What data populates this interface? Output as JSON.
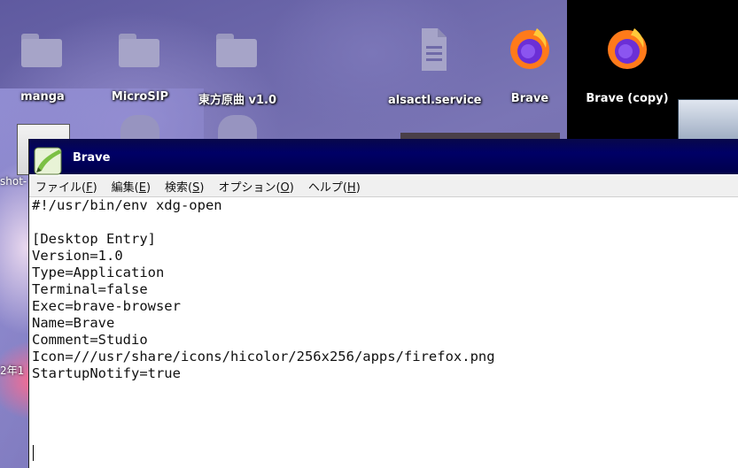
{
  "desktop": {
    "icons": [
      {
        "label": "manga",
        "icon": "folder-icon"
      },
      {
        "label": "MicroSIP",
        "icon": "folder-icon"
      },
      {
        "label": "東方原曲 v1.0",
        "icon": "folder-icon"
      },
      {
        "label": "alsactl.service",
        "icon": "document-icon"
      },
      {
        "label": "Brave",
        "icon": "firefox-icon"
      },
      {
        "label": "Brave (copy)",
        "icon": "firefox-icon"
      }
    ],
    "partial_label_left": "shot-",
    "partial_date_left": "2年1"
  },
  "window": {
    "title": "Brave",
    "app_icon": "text-editor-icon",
    "menu": [
      {
        "label": "ファイル(",
        "accel": "F",
        "tail": ")"
      },
      {
        "label": "編集(",
        "accel": "E",
        "tail": ")"
      },
      {
        "label": "検索(",
        "accel": "S",
        "tail": ")"
      },
      {
        "label": "オプション(",
        "accel": "O",
        "tail": ")"
      },
      {
        "label": "ヘルプ(",
        "accel": "H",
        "tail": ")"
      }
    ],
    "content": "#!/usr/bin/env xdg-open\n\n[Desktop Entry]\nVersion=1.0\nType=Application\nTerminal=false\nExec=brave-browser\nName=Brave\nComment=Studio\nIcon=///usr/share/icons/hicolor/256x256/apps/firefox.png\nStartupNotify=true\n"
  },
  "colors": {
    "titlebar": "#000066",
    "desktop_black_panel": "#000000",
    "firefox_orange": "#ff7a1a",
    "firefox_purple": "#6b2fd6"
  }
}
